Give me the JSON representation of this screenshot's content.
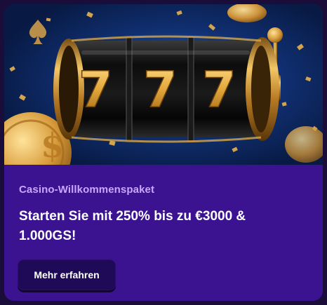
{
  "promo": {
    "subtitle": "Casino-Willkommenspaket",
    "headline": "Starten Sie mit 250% bis zu €3000 & 1.000GS!",
    "cta_label": "Mehr erfahren",
    "reel_symbols": [
      "7",
      "7",
      "7"
    ],
    "image_icons": [
      "slot-machine-icon",
      "spade-icon",
      "gold-coin-icon"
    ]
  },
  "colors": {
    "card_bg": "#3b1391",
    "subtitle": "#c8a8ff",
    "headline": "#ffffff",
    "button_bg": "#1e0a56",
    "gold": "#e7b04a",
    "hero_bg": "#0e2a66"
  }
}
